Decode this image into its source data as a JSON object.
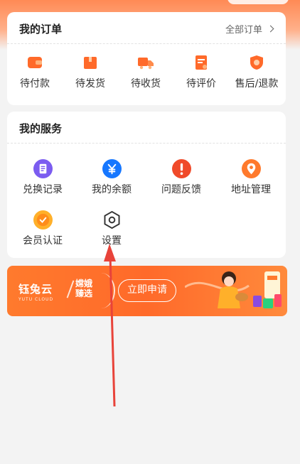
{
  "orders": {
    "title": "我的订单",
    "all_link": "全部订单",
    "items": [
      {
        "label": "待付款",
        "icon": "wallet-icon"
      },
      {
        "label": "待发货",
        "icon": "package-icon"
      },
      {
        "label": "待收货",
        "icon": "truck-icon"
      },
      {
        "label": "待评价",
        "icon": "review-icon"
      },
      {
        "label": "售后/退款",
        "icon": "refund-shield-icon"
      }
    ]
  },
  "services": {
    "title": "我的服务",
    "items": [
      {
        "label": "兑换记录",
        "icon": "exchange-record-icon"
      },
      {
        "label": "我的余额",
        "icon": "yen-balance-icon"
      },
      {
        "label": "问题反馈",
        "icon": "exclamation-icon"
      },
      {
        "label": "地址管理",
        "icon": "location-pin-icon"
      },
      {
        "label": "会员认证",
        "icon": "member-badge-icon"
      },
      {
        "label": "设置",
        "icon": "hexagon-settings-icon"
      }
    ]
  },
  "banner": {
    "brand": "钰兔云",
    "brand_sub": "YUTU CLOUD",
    "brand_second_line1": "嫦娥",
    "brand_second_line2": "臻选",
    "apply_label": "立即申请"
  },
  "colors": {
    "accent": "#ff6a2a",
    "service_purple": "#7b5cf0",
    "service_blue": "#1677ff",
    "service_red": "#f04a2a",
    "service_orange": "#ff7a2d"
  }
}
